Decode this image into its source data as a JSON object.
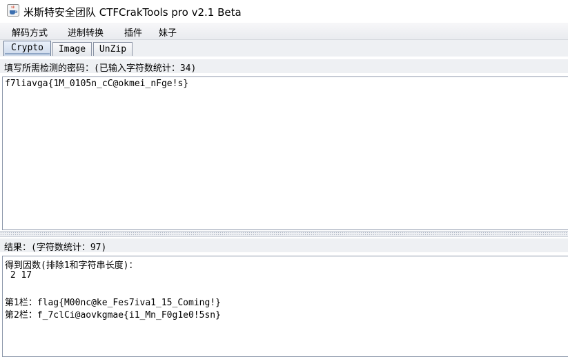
{
  "window": {
    "title": "米斯特安全团队 CTFCrakTools pro v2.1 Beta",
    "icon": "java-coffee-cup-icon"
  },
  "menu": [
    "解码方式",
    "进制转换",
    "插件",
    "妹子"
  ],
  "tabs": [
    {
      "label": "Crypto",
      "active": true
    },
    {
      "label": "Image",
      "active": false
    },
    {
      "label": "UnZip",
      "active": false
    }
  ],
  "input_panel": {
    "label": "填写所需检测的密码：(已输入字符数统计：34)",
    "value": "f7liavga{1M_0105n_cC@okmei_nFge!s}"
  },
  "result_panel": {
    "label": "结果：(字符数统计：97)",
    "lines": [
      "得到因数(排除1和字符串长度)：",
      " 2 17",
      "",
      "第1栏：flag{M00nc@ke_Fes7iva1_15_Coming!}",
      "第2栏：f_7clCi@aovkgmae{i1_Mn_F0g1e0!5sn}"
    ]
  },
  "colors": {
    "tab_active": "#cdd9ea",
    "panel_bg": "#eef0f3",
    "border": "#8a95a8"
  }
}
